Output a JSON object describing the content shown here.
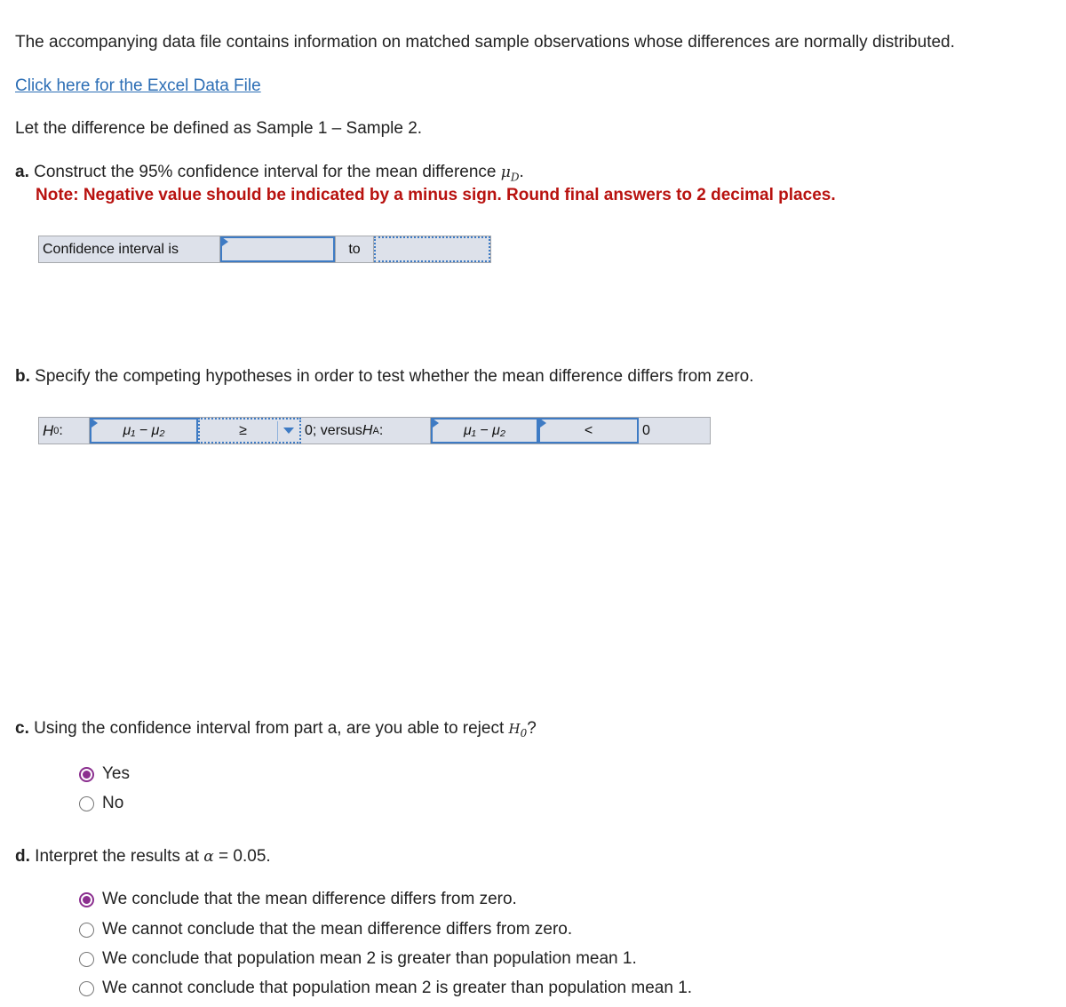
{
  "intro": {
    "text": "The accompanying data file contains information on matched sample observations whose differences are normally distributed.",
    "link_label": "Click here for the Excel Data File",
    "difference_definition": "Let the difference be defined as Sample 1 – Sample 2."
  },
  "part_a": {
    "letter": "a.",
    "prompt": " Construct the 95% confidence interval for the mean difference ",
    "symbol": "μ",
    "symbol_sub": "D",
    "period": ".",
    "note": "Note: Negative value should be indicated by a minus sign. Round final answers to 2 decimal places.",
    "table": {
      "label": "Confidence interval is",
      "lower_value": "",
      "separator": "to",
      "upper_value": ""
    }
  },
  "part_b": {
    "letter": "b.",
    "prompt": " Specify the competing hypotheses in order to test whether the mean difference differs from zero.",
    "table": {
      "h0_label": "H",
      "h0_sub": "0",
      "h0_colon": ":",
      "h0_param": "μ₁ − μ₂",
      "h0_operator": "≥",
      "h0_value_text": "0; versus ",
      "ha_label": "H",
      "ha_sub": "A",
      "ha_colon": ":",
      "ha_param": "μ₁ − μ₂",
      "ha_operator": "<",
      "ha_value": "0"
    }
  },
  "part_c": {
    "letter": "c.",
    "prompt": " Using the confidence interval from part a, are you able to reject ",
    "symbol": "H",
    "symbol_sub": "0",
    "end": "?",
    "options": [
      {
        "label": "Yes",
        "checked": true
      },
      {
        "label": "No",
        "checked": false
      }
    ]
  },
  "part_d": {
    "letter": "d.",
    "prompt": " Interpret the results at ",
    "alpha_symbol": "α",
    "alpha_value": " = 0.05.",
    "options": [
      {
        "label": "We conclude that the mean difference differs from zero.",
        "checked": true
      },
      {
        "label": "We cannot conclude that the mean difference differs from zero.",
        "checked": false
      },
      {
        "label": "We conclude that population mean 2 is greater than population mean 1.",
        "checked": false
      },
      {
        "label": "We cannot conclude that population mean 2 is greater than population mean 1.",
        "checked": false
      }
    ]
  },
  "colors": {
    "link": "#2c6eb5",
    "note_red": "#b8120f",
    "input_border": "#3e7bc4",
    "table_bg": "#dde1ea",
    "radio_selected": "#8b2f8f"
  }
}
